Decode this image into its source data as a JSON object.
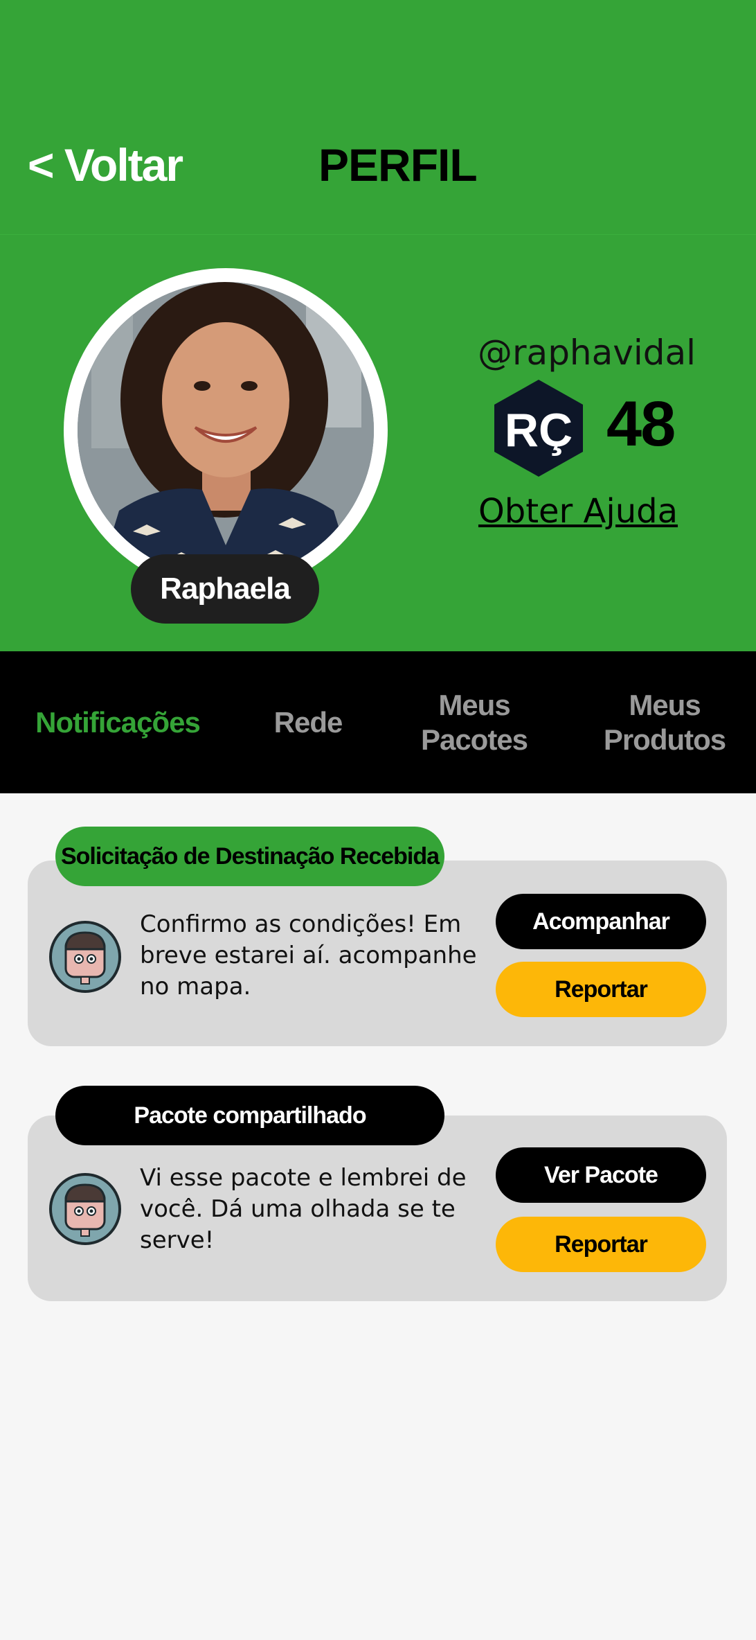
{
  "header": {
    "back_label": "< Voltar",
    "title": "PERFIL",
    "background_color": "#35a437"
  },
  "profile": {
    "name": "Raphaela",
    "handle": "@raphavidal",
    "currency_symbol": "RÇ",
    "currency_amount": "48",
    "help_label": "Obter Ajuda"
  },
  "tabs": [
    {
      "label": "Notificações",
      "active": true
    },
    {
      "label": "Rede",
      "active": false
    },
    {
      "label": "Meus Pacotes",
      "active": false
    },
    {
      "label": "Meus Produtos",
      "active": false
    }
  ],
  "notifications": [
    {
      "tag": "Solicitação de Destinação Recebida",
      "tag_color": "#35a437",
      "message": "Confirmo as condições! Em breve estarei aí. acompanhe no mapa.",
      "primary_action": "Acompanhar",
      "secondary_action": "Reportar",
      "avatar_icon": "user-avatar-icon"
    },
    {
      "tag": "Pacote compartilhado",
      "tag_color": "#000000",
      "message": "Vi esse pacote e lembrei de você. Dá uma olhada se te serve!",
      "primary_action": "Ver Pacote",
      "secondary_action": "Reportar",
      "avatar_icon": "user-avatar-icon"
    }
  ],
  "colors": {
    "brand_green": "#35a437",
    "report_yellow": "#fdb708",
    "card_gray": "#d9d9d9"
  }
}
